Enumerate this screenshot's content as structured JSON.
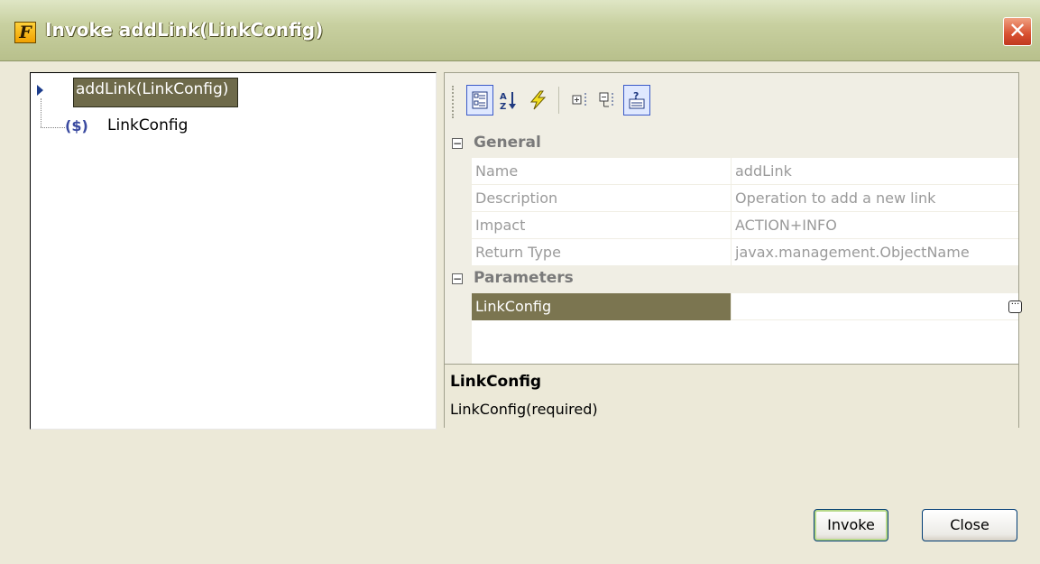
{
  "window": {
    "title": "Invoke addLink(LinkConfig)",
    "app_icon_glyph": "F",
    "close_glyph": "✕"
  },
  "tree": {
    "root": {
      "label": "addLink(LinkConfig)",
      "icon": "expand-arrow-icon"
    },
    "children": [
      {
        "icon_text": "($)",
        "label": "LinkConfig"
      }
    ]
  },
  "toolbar": {
    "buttons": [
      {
        "name": "categorized-view-button",
        "glyph": "▦",
        "pressed": true
      },
      {
        "name": "alphabetical-sort-button",
        "glyph": "A↓",
        "pressed": false
      },
      {
        "name": "events-button",
        "glyph": "⚡",
        "pressed": false
      },
      {
        "name": "expand-all-button",
        "glyph": "⊞",
        "pressed": false
      },
      {
        "name": "collapse-all-button",
        "glyph": "⊟",
        "pressed": false
      },
      {
        "name": "help-pane-button",
        "glyph": "?",
        "pressed": true
      }
    ]
  },
  "properties": {
    "categories": [
      {
        "label": "General",
        "toggle": "−",
        "rows": [
          {
            "name": "Name",
            "value": "addLink"
          },
          {
            "name": "Description",
            "value": "Operation to add a new link"
          },
          {
            "name": "Impact",
            "value": "ACTION+INFO"
          },
          {
            "name": "Return Type",
            "value": "javax.management.ObjectName"
          }
        ]
      },
      {
        "label": "Parameters",
        "toggle": "−",
        "rows": [
          {
            "name": "LinkConfig",
            "value": "",
            "selected": true,
            "ellipsis": "···"
          }
        ]
      }
    ]
  },
  "help": {
    "title": "LinkConfig",
    "description": "LinkConfig(required)"
  },
  "buttons": {
    "invoke": "Invoke",
    "close": "Close"
  },
  "colors": {
    "titlebar": "#c8d0a0",
    "selection": "#7b7550",
    "dialog_bg": "#ece9d8"
  }
}
